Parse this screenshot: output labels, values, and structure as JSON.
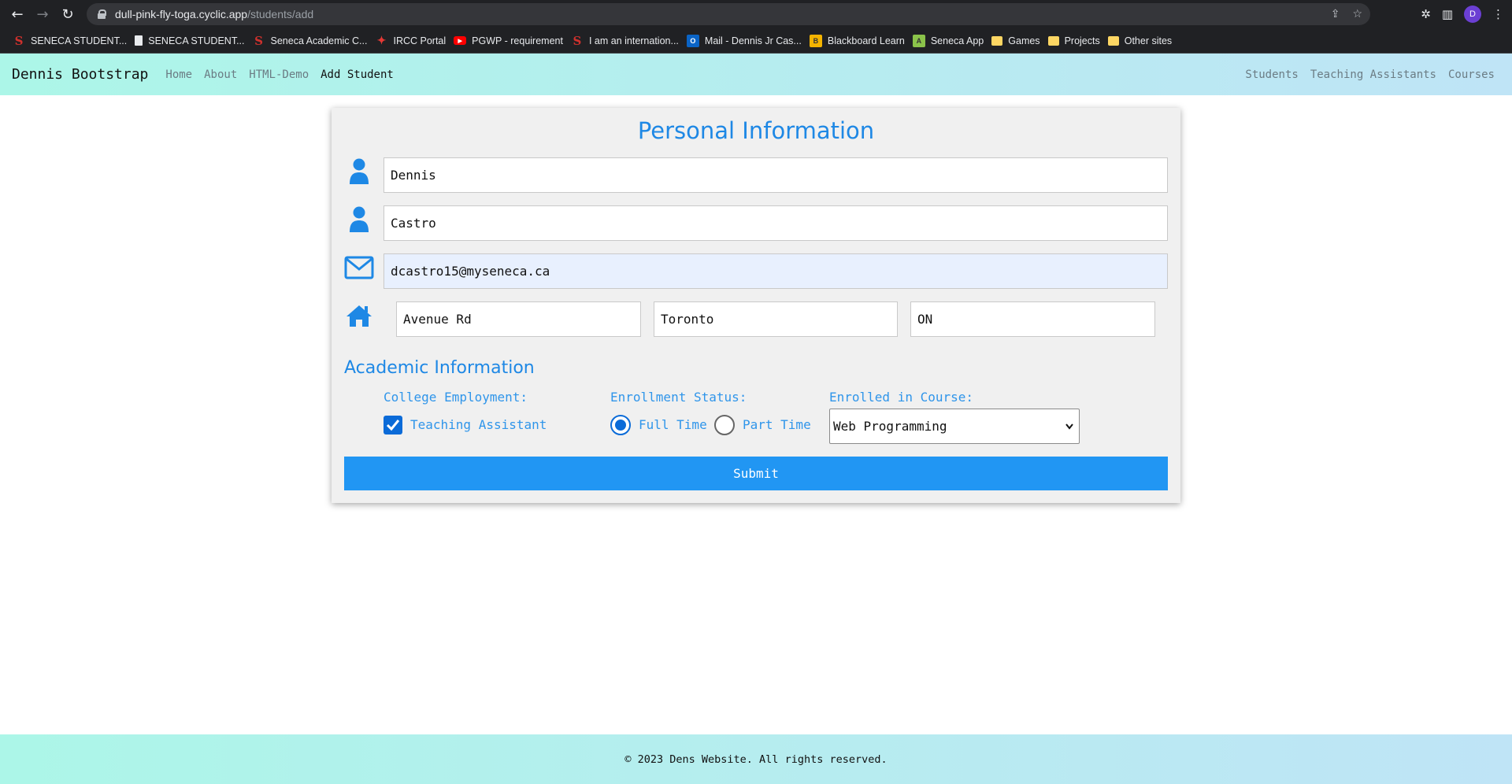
{
  "browser": {
    "url_host": "dull-pink-fly-toga.cyclic.app",
    "url_path": "/students/add",
    "profile_initial": "D",
    "bookmarks": [
      {
        "label": "SENECA STUDENT...",
        "icon": "seneca-icon"
      },
      {
        "label": "SENECA STUDENT...",
        "icon": "document-icon"
      },
      {
        "label": "Seneca Academic C...",
        "icon": "seneca-icon"
      },
      {
        "label": "IRCC Portal",
        "icon": "maple-leaf-icon"
      },
      {
        "label": "PGWP - requirement",
        "icon": "youtube-icon"
      },
      {
        "label": "I am an internation...",
        "icon": "seneca-icon"
      },
      {
        "label": "Mail - Dennis Jr Cas...",
        "icon": "outlook-icon"
      },
      {
        "label": "Blackboard Learn",
        "icon": "blackboard-icon"
      },
      {
        "label": "Seneca App",
        "icon": "app-icon"
      },
      {
        "label": "Games",
        "icon": "folder-icon"
      },
      {
        "label": "Projects",
        "icon": "folder-icon"
      },
      {
        "label": "Other sites",
        "icon": "folder-icon"
      }
    ]
  },
  "nav": {
    "brand": "Dennis Bootstrap",
    "links": [
      "Home",
      "About",
      "HTML-Demo",
      "Add Student"
    ],
    "active_link": "Add Student",
    "right_links": [
      "Students",
      "Teaching Assistants",
      "Courses"
    ]
  },
  "form": {
    "title": "Personal Information",
    "first_name": "Dennis",
    "last_name": "Castro",
    "email": "dcastro15@myseneca.ca",
    "street": "Avenue Rd",
    "city": "Toronto",
    "province": "ON",
    "academic_title": "Academic Information",
    "employment_label": "College Employment:",
    "teaching_assistant_label": "Teaching Assistant",
    "teaching_assistant_checked": true,
    "status_label": "Enrollment Status:",
    "full_time_label": "Full Time",
    "part_time_label": "Part Time",
    "status_selected": "Full Time",
    "course_label": "Enrolled in Course:",
    "course_selected": "Web Programming",
    "submit_label": "Submit",
    "accent_color": "#1e88e5"
  },
  "footer": {
    "text": "© 2023 Dens Website. All rights reserved."
  }
}
